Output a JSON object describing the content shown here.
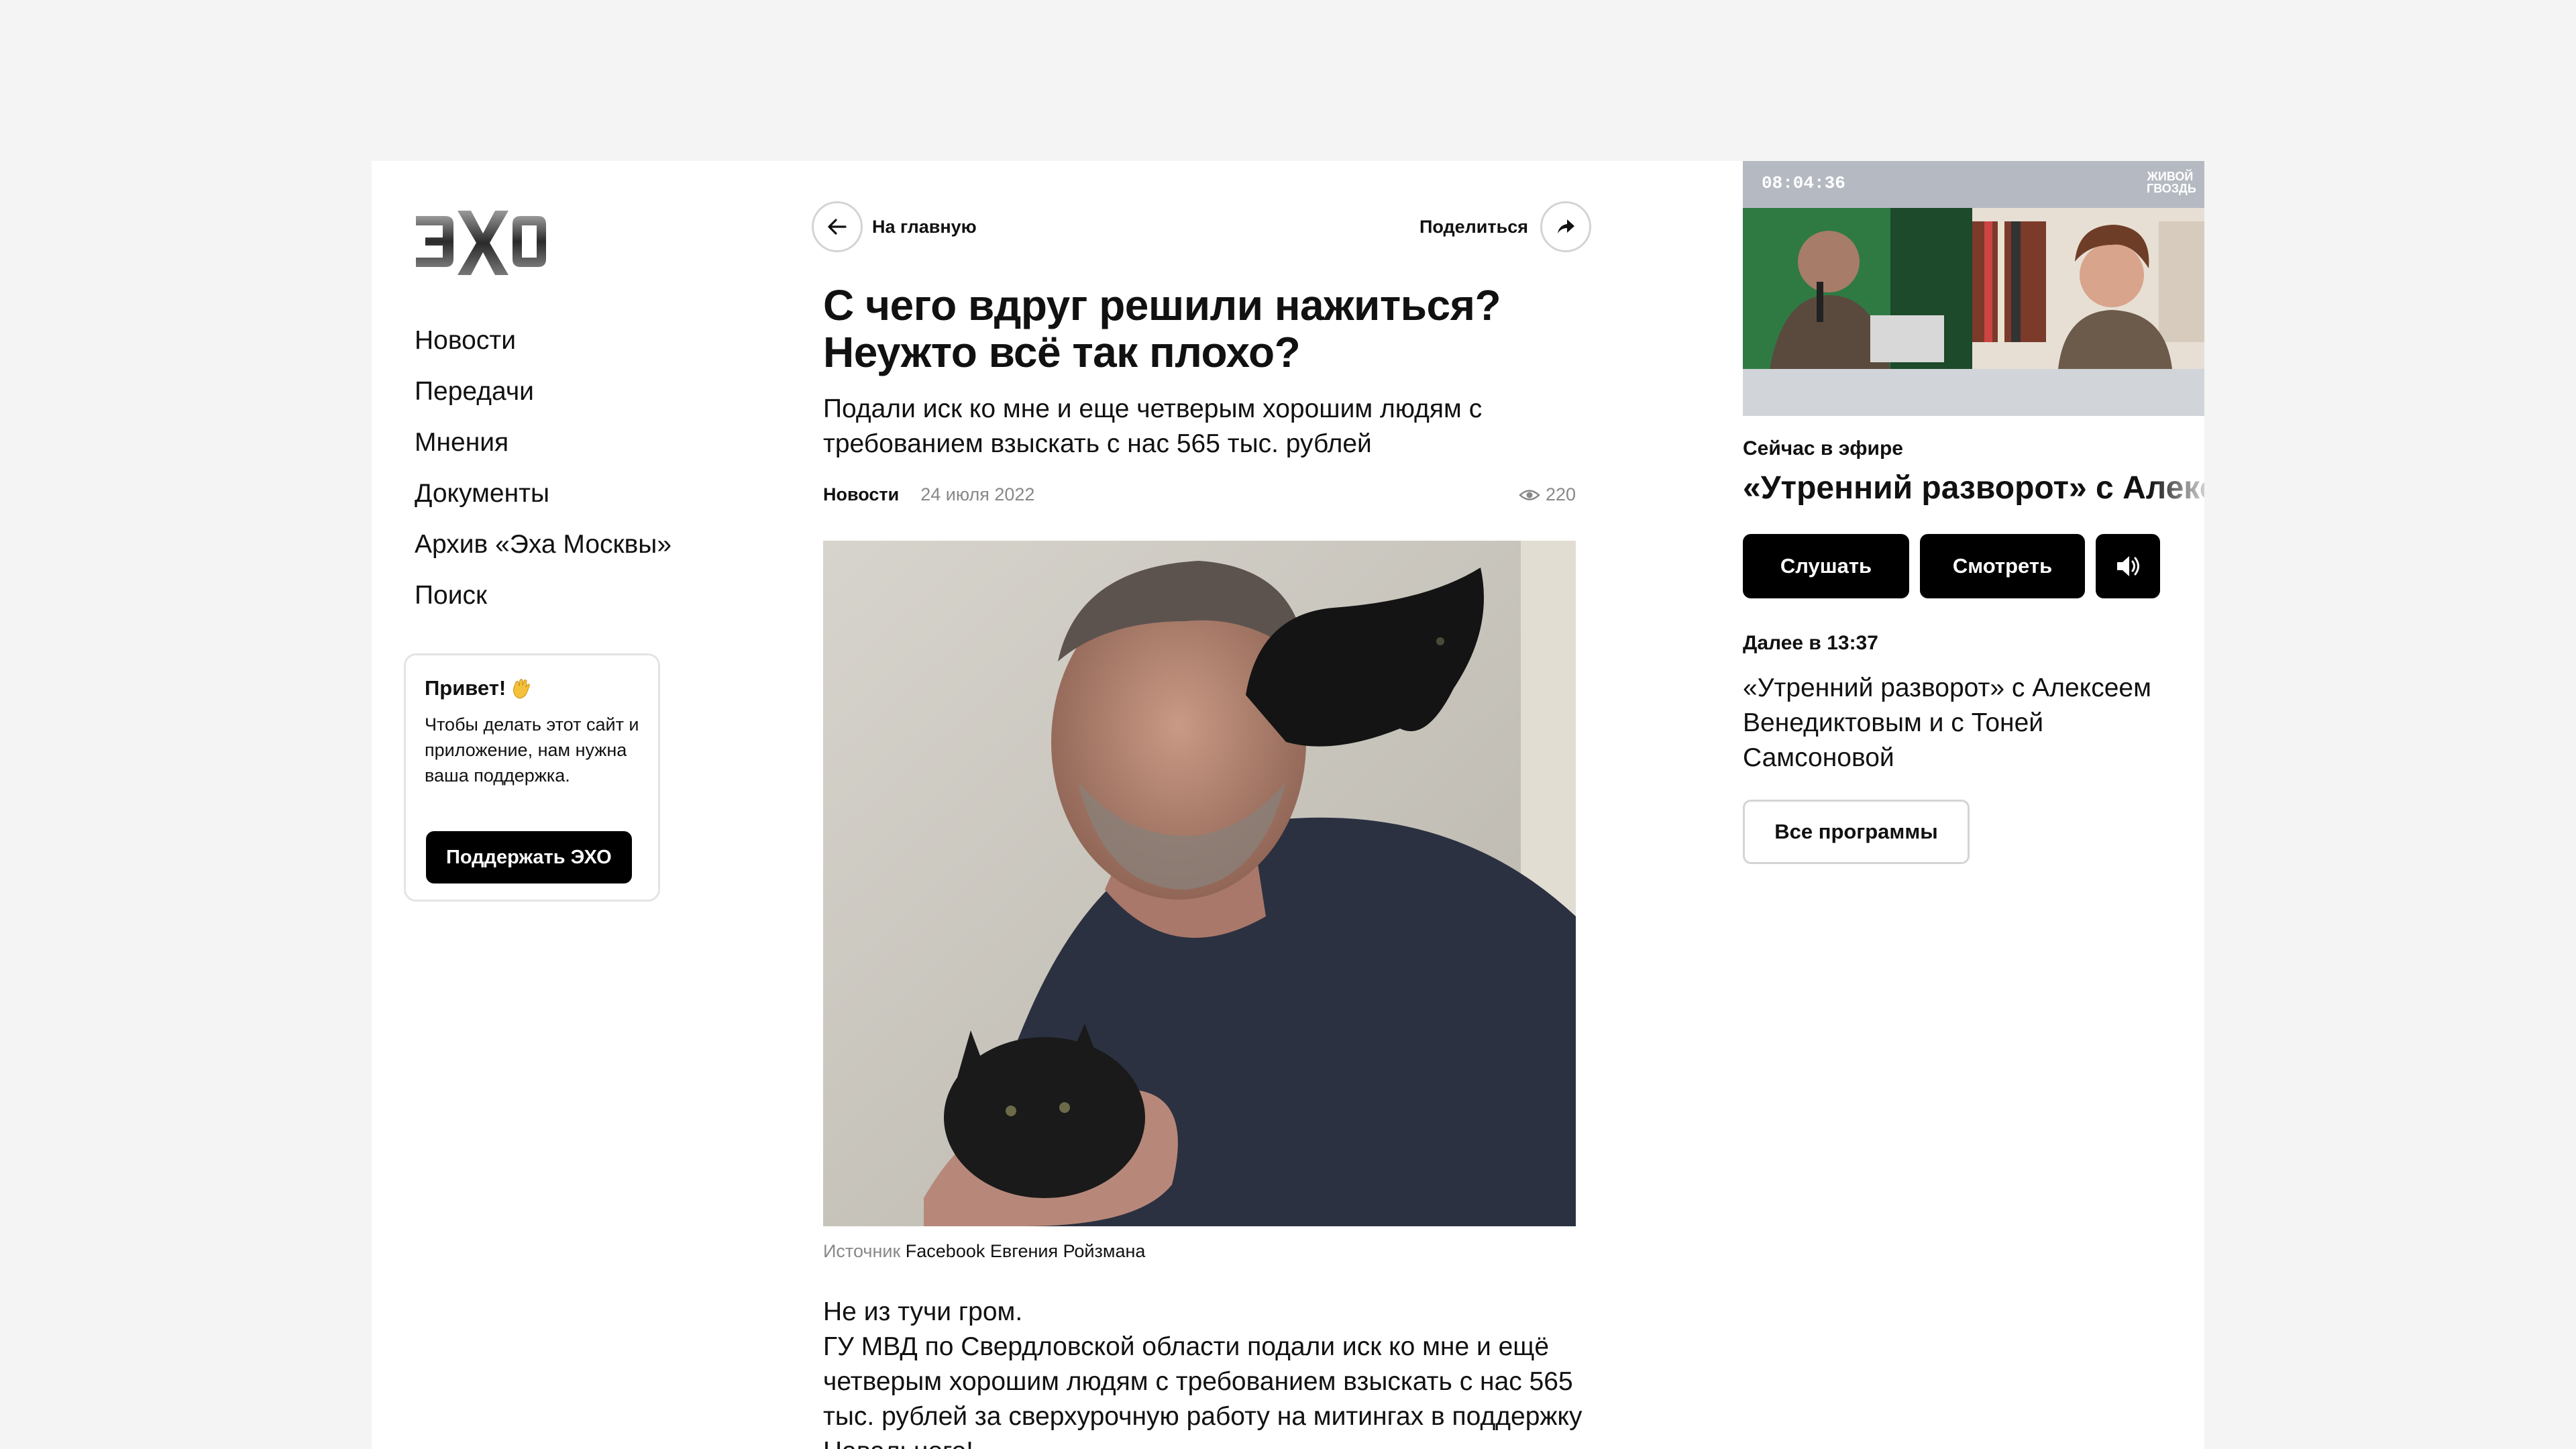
{
  "brand": {
    "logo_text": "ЭХО"
  },
  "nav": {
    "items": [
      {
        "label": "Новости"
      },
      {
        "label": "Передачи"
      },
      {
        "label": "Мнения"
      },
      {
        "label": "Документы"
      },
      {
        "label": "Архив «Эха Москвы»"
      },
      {
        "label": "Поиск"
      }
    ]
  },
  "support": {
    "title": "Привет!",
    "text": "Чтобы делать этот сайт и приложение, нам нужна ваша поддержка.",
    "button_label": "Поддержать ЭХО"
  },
  "article": {
    "back_label": "На главную",
    "share_label": "Поделиться",
    "title": "С чего вдруг решили нажиться? Неужто всё так плохо?",
    "subtitle": "Подали иск ко мне и еще четверым хорошим людям с требованием взыскать с нас 565 тыс. рублей",
    "category": "Новости",
    "date": "24 июля 2022",
    "views": "220",
    "caption_prefix": "Источник",
    "caption_source": "Facebook Евгения Ройзмана",
    "body": [
      "Не из тучи гром.",
      "ГУ МВД по Свердловской области подали иск ко мне и ещё четверым хорошим людям с требованием взыскать с нас 565 тыс. рублей за сверхурочную работу на митингах в поддержку Навального!"
    ]
  },
  "live": {
    "timer": "08:04:36",
    "badge": "ЖИВОЙ ГВОЗДЬ",
    "on_air_label": "Сейчас в эфире",
    "on_air_title": "«Утренний разворот» с Алексеем Венедиктовым",
    "listen_label": "Слушать",
    "watch_label": "Смотреть",
    "next_label": "Далее в 13:37",
    "next_title": "«Утренний разворот» с Алексеем Венедиктовым и с Тоней Самсоновой",
    "all_programs_label": "Все программы"
  },
  "icons": {
    "back": "arrow-left-icon",
    "share": "share-arrow-icon",
    "views": "eye-icon",
    "volume": "speaker-icon",
    "wave": "waving-hand-icon"
  },
  "colors": {
    "accent": "#000000",
    "background": "#f4f4f4",
    "muted": "#888888"
  }
}
